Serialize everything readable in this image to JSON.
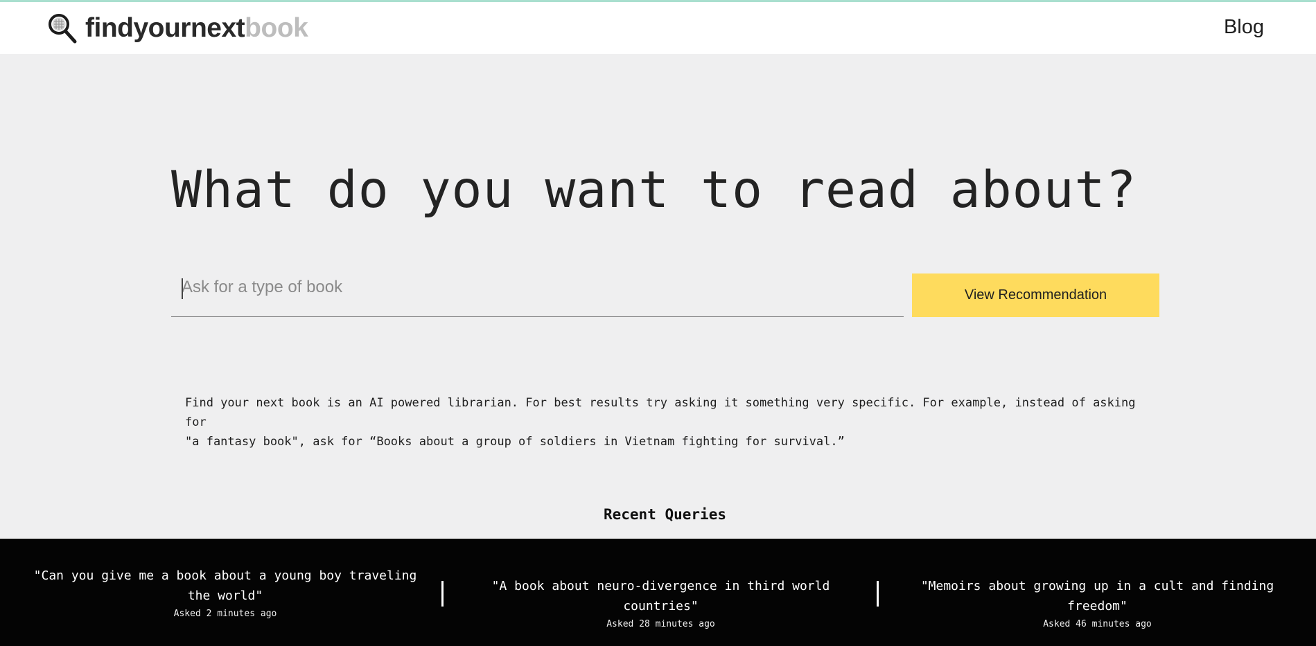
{
  "header": {
    "logo_dark": "findyournext",
    "logo_light": "book",
    "nav_blog": "Blog",
    "logo_icon": "magnifier-book-icon"
  },
  "hero": {
    "title": "What do you want to read about?",
    "search_placeholder": "Ask for a type of book",
    "search_value": "",
    "cta_label": "View Recommendation",
    "intro_line1": "Find your next book is an AI powered librarian. For best results try asking it something very specific. For example, instead of asking for",
    "intro_line2": "\"a fantasy book\", ask for “Books about a group of soldiers in Vietnam fighting for survival.”"
  },
  "recent": {
    "title": "Recent Queries",
    "items": [
      {
        "text": "\"Can you give me a book about a young boy traveling the world\"",
        "meta": "Asked 2 minutes ago"
      },
      {
        "text": "\"A book about neuro-divergence in third world countries\"",
        "meta": "Asked 28 minutes ago"
      },
      {
        "text": "\"Memoirs about growing up in a cult and finding freedom\"",
        "meta": "Asked 46 minutes ago"
      }
    ]
  },
  "colors": {
    "accent_button": "#fedb5d",
    "top_line": "#a9dfcf",
    "page_bg": "#efeff0",
    "strip_bg": "#040404"
  }
}
